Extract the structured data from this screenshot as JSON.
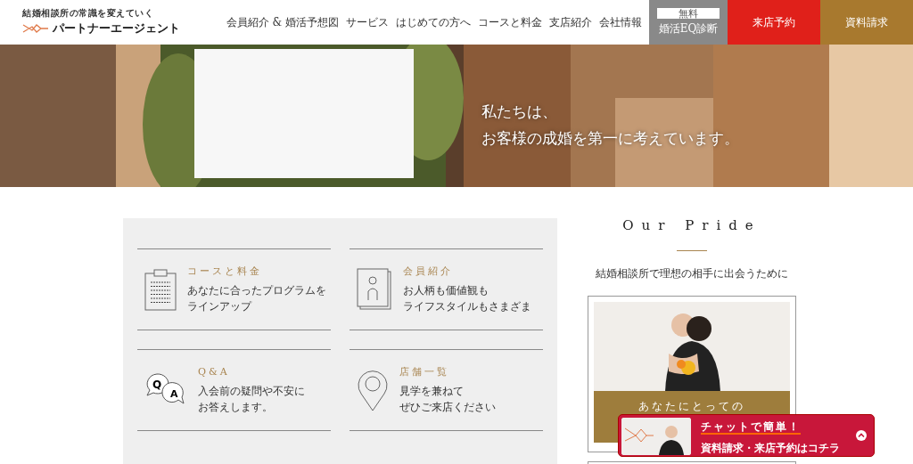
{
  "header": {
    "tagline": "結婚相談所の常識を変えていく",
    "brand": "パートナーエージェント",
    "nav": [
      {
        "label": "会員紹介 & 婚活予想図"
      },
      {
        "label": "サービス"
      },
      {
        "label": "はじめての方へ"
      },
      {
        "label": "コースと料金"
      },
      {
        "label": "支店紹介"
      },
      {
        "label": "会社情報"
      }
    ],
    "eq_button": {
      "badge": "無料",
      "label": "婚活EQ診断"
    },
    "cta": [
      {
        "label": "来店予約",
        "color": "#e0201a"
      },
      {
        "label": "資料請求",
        "color": "#a8792e"
      }
    ]
  },
  "hero": {
    "kind": "picture",
    "lines": [
      "私たちは、",
      "お客様の成婚を第一に考えています。"
    ]
  },
  "features": [
    {
      "kind": "clipboard",
      "title": "コースと料金",
      "lines": [
        "あなたに合ったプログラムを",
        "ラインアップ"
      ]
    },
    {
      "kind": "profile",
      "title": "会員紹介",
      "lines": [
        "お人柄も価値観も",
        "ライフスタイルもさまざま"
      ]
    },
    {
      "kind": "qa",
      "icon_letters": [
        "Q",
        "A"
      ],
      "title": "Q&A",
      "lines": [
        "入会前の疑問や不安に",
        "お答えします。"
      ]
    },
    {
      "kind": "pin",
      "title": "店舗一覧",
      "lines": [
        "見学を兼ねて",
        "ぜひご来店ください"
      ]
    }
  ],
  "pride": {
    "title": "Our Pride",
    "subtitle": "結婚相談所で理想の相手に出会うために",
    "card_caption": "あなたにとっての"
  },
  "chat": {
    "line1": "チャットで簡単！",
    "line2": "資料請求・来店予約はコチラ"
  }
}
